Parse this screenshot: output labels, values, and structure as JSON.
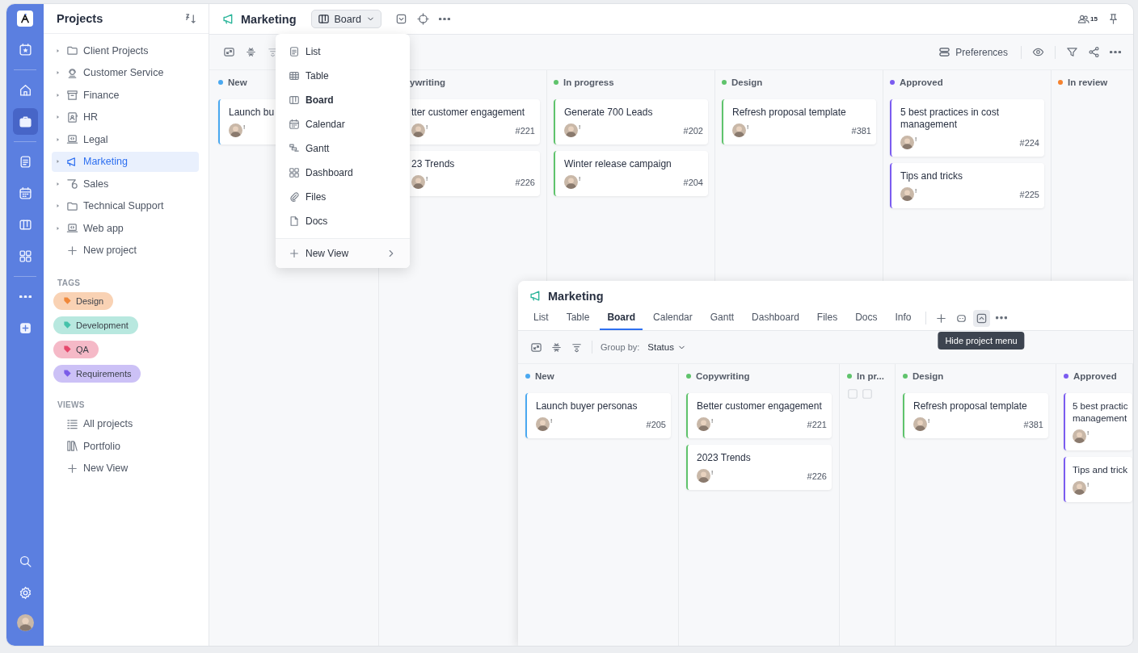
{
  "rail": {
    "items": [
      {
        "selected": false
      },
      {
        "selected": false
      },
      {
        "selected": true
      },
      {
        "selected": false
      },
      {
        "selected": false
      },
      {
        "selected": false
      },
      {
        "selected": false
      },
      {
        "selected": false
      },
      {
        "selected": false
      }
    ]
  },
  "sidebar": {
    "title": "Projects",
    "projects": [
      {
        "label": "Client Projects",
        "selected": false
      },
      {
        "label": "Customer Service",
        "selected": false
      },
      {
        "label": "Finance",
        "selected": false
      },
      {
        "label": "HR",
        "selected": false
      },
      {
        "label": "Legal",
        "selected": false
      },
      {
        "label": "Marketing",
        "selected": true
      },
      {
        "label": "Sales",
        "selected": false
      },
      {
        "label": "Technical Support",
        "selected": false
      },
      {
        "label": "Web app",
        "selected": false
      }
    ],
    "new_project": "New project",
    "tags_heading": "TAGS",
    "tags": [
      {
        "label": "Design",
        "color": "#f0883a"
      },
      {
        "label": "Development",
        "color": "#45c2aa"
      },
      {
        "label": "QA",
        "color": "#e5476b"
      },
      {
        "label": "Requirements",
        "color": "#7a5ce8"
      }
    ],
    "views_heading": "VIEWS",
    "views": [
      {
        "label": "All projects"
      },
      {
        "label": "Portfolio"
      },
      {
        "label": "New View"
      }
    ]
  },
  "header": {
    "title": "Marketing",
    "view_button": {
      "label": "Board",
      "expanded": true
    },
    "member_count": "15"
  },
  "toolbar": {
    "preferences": "Preferences"
  },
  "view_menu": {
    "items": [
      {
        "label": "List",
        "selected": false
      },
      {
        "label": "Table",
        "selected": false
      },
      {
        "label": "Board",
        "selected": true
      },
      {
        "label": "Calendar",
        "selected": false
      },
      {
        "label": "Gantt",
        "selected": false
      },
      {
        "label": "Dashboard",
        "selected": false
      },
      {
        "label": "Files",
        "selected": false
      },
      {
        "label": "Docs",
        "selected": false
      }
    ],
    "new_view": "New View"
  },
  "board": {
    "columns": [
      {
        "title": "New",
        "color": "#4aa8f0",
        "cards": [
          {
            "title": "Launch bu",
            "badge": "!"
          }
        ]
      },
      {
        "title": "ywriting",
        "cards": [
          {
            "title": "tter customer engagement",
            "number": "#221",
            "badge": "!"
          },
          {
            "title": "23 Trends",
            "number": "#226",
            "badge": "!"
          }
        ]
      },
      {
        "title": "In progress",
        "color": "#5fc36c",
        "cards": [
          {
            "title": "Generate 700 Leads",
            "number": "#202",
            "badge": "!"
          },
          {
            "title": "Winter release campaign",
            "number": "#204",
            "badge": "!"
          }
        ]
      },
      {
        "title": "Design",
        "color": "#5fc36c",
        "cards": [
          {
            "title": "Refresh proposal template",
            "number": "#381",
            "badge": "!"
          }
        ]
      },
      {
        "title": "Approved",
        "color": "#7b5cf0",
        "cards": [
          {
            "title": "5 best practices in cost management",
            "number": "#224",
            "badge": "!"
          },
          {
            "title": "Tips and tricks",
            "number": "#225",
            "badge": "!"
          }
        ]
      },
      {
        "title": "In review",
        "color": "#f5822f"
      }
    ]
  },
  "panel": {
    "title": "Marketing",
    "tabs": [
      {
        "label": "List",
        "selected": false
      },
      {
        "label": "Table",
        "selected": false
      },
      {
        "label": "Board",
        "selected": true
      },
      {
        "label": "Calendar",
        "selected": false
      },
      {
        "label": "Gantt",
        "selected": false
      },
      {
        "label": "Dashboard",
        "selected": false
      },
      {
        "label": "Files",
        "selected": false
      },
      {
        "label": "Docs",
        "selected": false
      },
      {
        "label": "Info",
        "selected": false
      }
    ],
    "tooltip": "Hide project menu",
    "group_by_label": "Group by:",
    "group_by_value": "Status",
    "columns": [
      {
        "title": "New",
        "color": "#4aa8f0",
        "collapsed": false,
        "cards": [
          {
            "title": "Launch buyer personas",
            "number": "#205",
            "badge": "!"
          }
        ]
      },
      {
        "title": "Copywriting",
        "color": "#5fc36c",
        "collapsed": false,
        "cards": [
          {
            "title": "Better customer engagement",
            "number": "#221",
            "badge": "!"
          },
          {
            "title": "2023 Trends",
            "number": "#226",
            "badge": "!"
          }
        ]
      },
      {
        "title": "In pr...",
        "color": "#5fc36c",
        "collapsed": true
      },
      {
        "title": "Design",
        "color": "#5fc36c",
        "collapsed": false,
        "cards": [
          {
            "title": "Refresh proposal template",
            "number": "#381",
            "badge": "!"
          }
        ]
      },
      {
        "title": "Approved",
        "color": "#7b5cf0",
        "collapsed": false,
        "cards": [
          {
            "title": "5 best practic\nmanagement",
            "badge": "!"
          },
          {
            "title": "Tips and trick",
            "badge": "!"
          }
        ]
      }
    ]
  }
}
